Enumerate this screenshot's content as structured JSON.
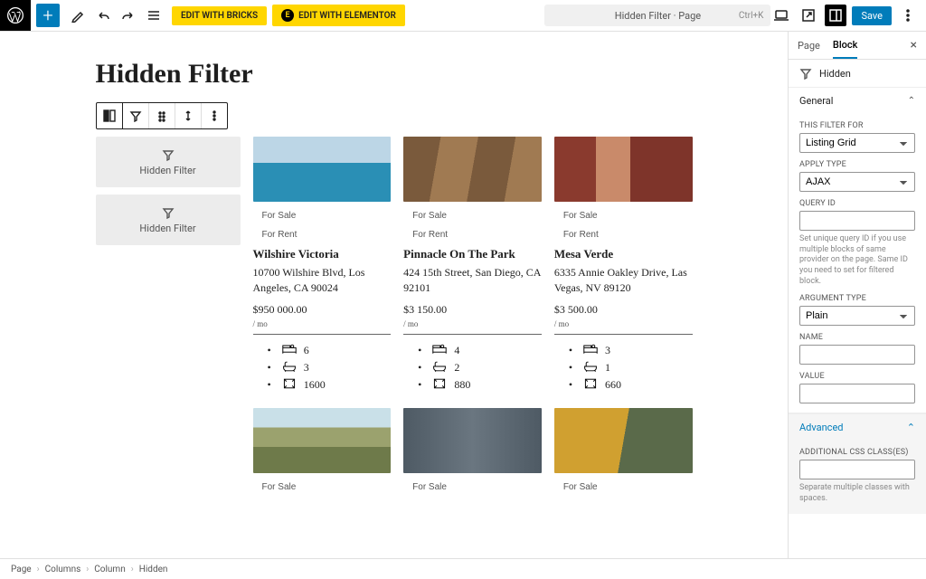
{
  "topbar": {
    "doc_title": "Hidden Filter · Page",
    "shortcut": "Ctrl+K",
    "edit_bricks": "EDIT WITH BRICKS",
    "edit_elementor": "EDIT WITH ELEMENTOR",
    "save": "Save"
  },
  "page": {
    "title": "Hidden Filter",
    "hidden_filter_label": "Hidden Filter"
  },
  "listings": [
    {
      "img": "p1",
      "tag1": "For Sale",
      "tag2": "For Rent",
      "name": "Wilshire Victoria",
      "addr": "10700 Wilshire Blvd, Los Angeles, CA 90024",
      "price": "$950 000.00",
      "per": "/ mo",
      "beds": "6",
      "baths": "3",
      "area": "1600"
    },
    {
      "img": "p2",
      "tag1": "For Sale",
      "tag2": "For Rent",
      "name": "Pinnacle On The Park",
      "addr": "424 15th Street, San Diego, CA 92101",
      "price": "$3 150.00",
      "per": "/ mo",
      "beds": "4",
      "baths": "2",
      "area": "880"
    },
    {
      "img": "p3",
      "tag1": "For Sale",
      "tag2": "For Rent",
      "name": "Mesa Verde",
      "addr": "6335 Annie Oakley Drive, Las Vegas, NV 89120",
      "price": "$3 500.00",
      "per": "/ mo",
      "beds": "3",
      "baths": "1",
      "area": "660"
    },
    {
      "img": "p4",
      "tag1": "For Sale"
    },
    {
      "img": "p5",
      "tag1": "For Sale"
    },
    {
      "img": "p6",
      "tag1": "For Sale"
    }
  ],
  "sidebar": {
    "tabs": {
      "page": "Page",
      "block": "Block"
    },
    "block_name": "Hidden",
    "general": {
      "title": "General",
      "filter_for_lbl": "THIS FILTER FOR",
      "filter_for": "Listing Grid",
      "apply_type_lbl": "APPLY TYPE",
      "apply_type": "AJAX",
      "query_id_lbl": "QUERY ID",
      "query_id_help": "Set unique query ID if you use multiple blocks of same provider on the page. Same ID you need to set for filtered block.",
      "arg_type_lbl": "ARGUMENT TYPE",
      "arg_type": "Plain",
      "name_lbl": "NAME",
      "value_lbl": "VALUE"
    },
    "advanced": {
      "title": "Advanced",
      "css_lbl": "ADDITIONAL CSS CLASS(ES)",
      "css_help": "Separate multiple classes with spaces."
    }
  },
  "breadcrumb": [
    "Page",
    "Columns",
    "Column",
    "Hidden"
  ]
}
